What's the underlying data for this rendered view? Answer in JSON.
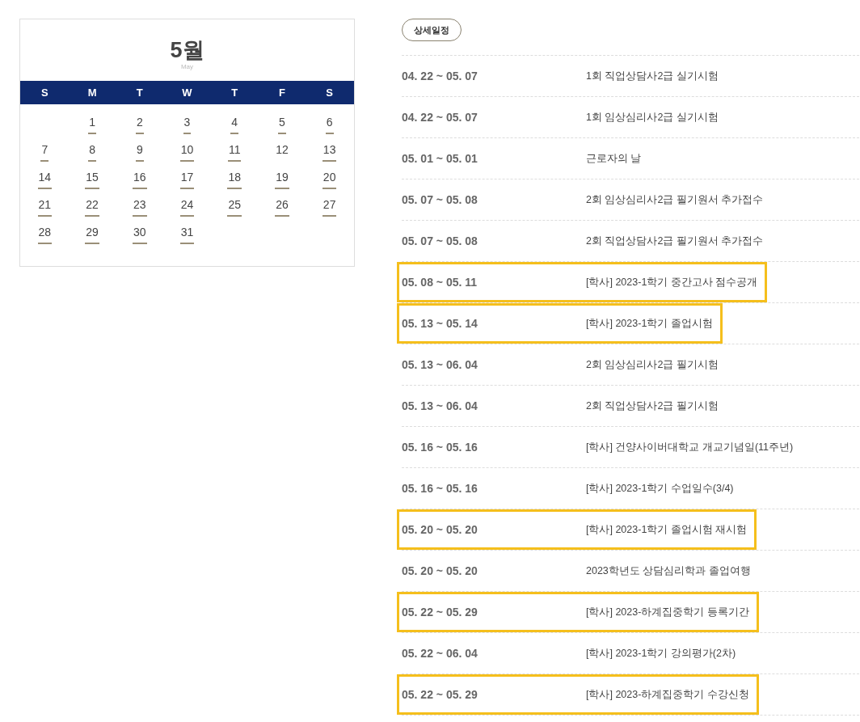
{
  "calendar": {
    "month": "5월",
    "month_en": "May",
    "weekdays": [
      "S",
      "M",
      "T",
      "W",
      "T",
      "F",
      "S"
    ],
    "weeks": [
      [
        {
          "day": "1",
          "has_event": true
        },
        {
          "day": "2",
          "has_event": true
        },
        {
          "day": "3",
          "has_event": true
        },
        {
          "day": "4",
          "has_event": true
        },
        {
          "day": "5",
          "has_event": true
        },
        {
          "day": "6",
          "has_event": true
        }
      ],
      [
        {
          "day": "7",
          "has_event": true
        },
        {
          "day": "8",
          "has_event": true
        },
        {
          "day": "9",
          "has_event": true
        },
        {
          "day": "10",
          "has_event": true
        },
        {
          "day": "11",
          "has_event": true
        },
        {
          "day": "12",
          "has_event": false
        },
        {
          "day": "13",
          "has_event": true
        }
      ],
      [
        {
          "day": "14",
          "has_event": true
        },
        {
          "day": "15",
          "has_event": true
        },
        {
          "day": "16",
          "has_event": true
        },
        {
          "day": "17",
          "has_event": true
        },
        {
          "day": "18",
          "has_event": true
        },
        {
          "day": "19",
          "has_event": true
        },
        {
          "day": "20",
          "has_event": true
        }
      ],
      [
        {
          "day": "21",
          "has_event": true
        },
        {
          "day": "22",
          "has_event": true
        },
        {
          "day": "23",
          "has_event": true
        },
        {
          "day": "24",
          "has_event": true
        },
        {
          "day": "25",
          "has_event": true
        },
        {
          "day": "26",
          "has_event": true
        },
        {
          "day": "27",
          "has_event": true
        }
      ],
      [
        {
          "day": "28",
          "has_event": true
        },
        {
          "day": "29",
          "has_event": true
        },
        {
          "day": "30",
          "has_event": true
        },
        {
          "day": "31",
          "has_event": true
        }
      ]
    ]
  },
  "schedule": {
    "button": "상세일정",
    "rows": [
      {
        "dates": "04. 22 ~ 05. 07",
        "title": "1회 직업상담사2급 실기시험",
        "highlighted": false
      },
      {
        "dates": "04. 22 ~ 05. 07",
        "title": "1회 임상심리사2급 실기시험",
        "highlighted": false
      },
      {
        "dates": "05. 01 ~ 05. 01",
        "title": "근로자의 날",
        "highlighted": false
      },
      {
        "dates": "05. 07 ~ 05. 08",
        "title": "2회 임상심리사2급 필기원서 추가접수",
        "highlighted": false
      },
      {
        "dates": "05. 07 ~ 05. 08",
        "title": "2회 직업상담사2급 필기원서 추가접수",
        "highlighted": false
      },
      {
        "dates": "05. 08 ~ 05. 11",
        "title": "[학사] 2023-1학기 중간고사 점수공개",
        "highlighted": true
      },
      {
        "dates": "05. 13 ~ 05. 14",
        "title": "[학사] 2023-1학기 졸업시험",
        "highlighted": true
      },
      {
        "dates": "05. 13 ~ 06. 04",
        "title": "2회 임상심리사2급 필기시험",
        "highlighted": false
      },
      {
        "dates": "05. 13 ~ 06. 04",
        "title": "2회 직업상담사2급 필기시험",
        "highlighted": false
      },
      {
        "dates": "05. 16 ~ 05. 16",
        "title": "[학사] 건양사이버대학교 개교기념일(11주년)",
        "highlighted": false
      },
      {
        "dates": "05. 16 ~ 05. 16",
        "title": "[학사] 2023-1학기 수업일수(3/4)",
        "highlighted": false
      },
      {
        "dates": "05. 20 ~ 05. 20",
        "title": "[학사] 2023-1학기 졸업시험 재시험",
        "highlighted": true
      },
      {
        "dates": "05. 20 ~ 05. 20",
        "title": "2023학년도 상담심리학과 졸업여행",
        "highlighted": false
      },
      {
        "dates": "05. 22 ~ 05. 29",
        "title": "[학사] 2023-하계집중학기 등록기간",
        "highlighted": true
      },
      {
        "dates": "05. 22 ~ 06. 04",
        "title": "[학사] 2023-1학기 강의평가(2차)",
        "highlighted": false
      },
      {
        "dates": "05. 22 ~ 05. 29",
        "title": "[학사] 2023-하계집중학기 수강신청",
        "highlighted": true
      }
    ]
  }
}
